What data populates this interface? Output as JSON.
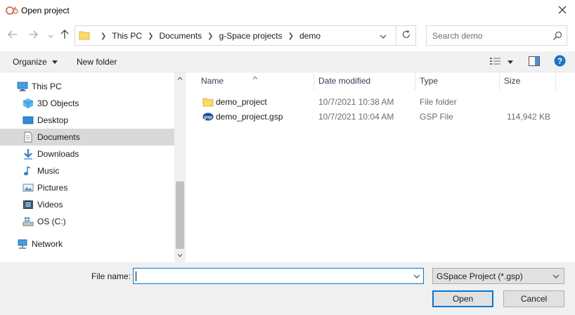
{
  "window": {
    "title": "Open project"
  },
  "address": {
    "crumbs": [
      "This PC",
      "Documents",
      "g-Space projects",
      "demo"
    ]
  },
  "search": {
    "placeholder": "Search demo"
  },
  "toolbar": {
    "organize_label": "Organize",
    "new_folder_label": "New folder"
  },
  "nav": {
    "items": [
      {
        "label": "This PC",
        "icon": "computer-icon"
      },
      {
        "label": "3D Objects",
        "icon": "cube-icon"
      },
      {
        "label": "Desktop",
        "icon": "desktop-icon"
      },
      {
        "label": "Documents",
        "icon": "documents-icon",
        "selected": true
      },
      {
        "label": "Downloads",
        "icon": "download-icon"
      },
      {
        "label": "Music",
        "icon": "music-icon"
      },
      {
        "label": "Pictures",
        "icon": "pictures-icon"
      },
      {
        "label": "Videos",
        "icon": "videos-icon"
      },
      {
        "label": "OS (C:)",
        "icon": "drive-icon"
      },
      {
        "label": "Network",
        "icon": "network-icon"
      }
    ]
  },
  "columns": [
    "Name",
    "Date modified",
    "Type",
    "Size"
  ],
  "files": [
    {
      "name": "demo_project",
      "date": "10/7/2021 10:38 AM",
      "type": "File folder",
      "size": "",
      "icon": "folder-icon"
    },
    {
      "name": "demo_project.gsp",
      "date": "10/7/2021 10:04 AM",
      "type": "GSP File",
      "size": "114,942 KB",
      "icon": "gsp-file-icon"
    }
  ],
  "bottom": {
    "file_name_label": "File name:",
    "file_name_value": "",
    "filter_value": "GSpace Project (*.gsp)",
    "open_label": "Open",
    "cancel_label": "Cancel"
  },
  "colors": {
    "accent": "#0078d7",
    "selection": "#d9d9d9",
    "help": "#1a73c9"
  }
}
